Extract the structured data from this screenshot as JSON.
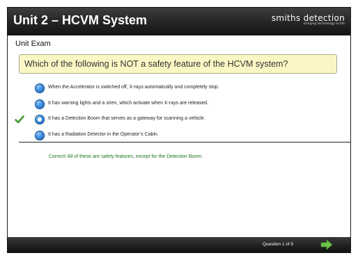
{
  "header": {
    "title": "Unit 2 – HCVM System",
    "brand_name": "smiths detection",
    "brand_tagline": "bringing technology to life"
  },
  "section_label": "Unit Exam",
  "question": "Which of the following is NOT a safety feature of the HCVM system?",
  "options": [
    {
      "text": "When the Accelerator is switched off, X-rays automatically and completely stop.",
      "selected": false,
      "correct_mark": false
    },
    {
      "text": "It has warning lights and a siren, which activate when X-rays are released.",
      "selected": false,
      "correct_mark": false
    },
    {
      "text": "It has a Detection Boom that serves as a gateway for scanning a vehicle.",
      "selected": true,
      "correct_mark": true
    },
    {
      "text": "It has a Radiation Detector in the Operator’s Cabin.",
      "selected": false,
      "correct_mark": false
    }
  ],
  "feedback": "Correct! All of these are safety features, except for the Detection Boom.",
  "footer": {
    "progress": "Question 1 of 5"
  },
  "icons": {
    "check": "check-icon",
    "next": "next-arrow-icon"
  },
  "colors": {
    "question_bg": "#fbf7c4",
    "feedback_text": "#1a7a1a",
    "check_mark": "#3f9a2c",
    "next_arrow": "#6cc24a",
    "radio_blue": "#2f7fd2"
  }
}
